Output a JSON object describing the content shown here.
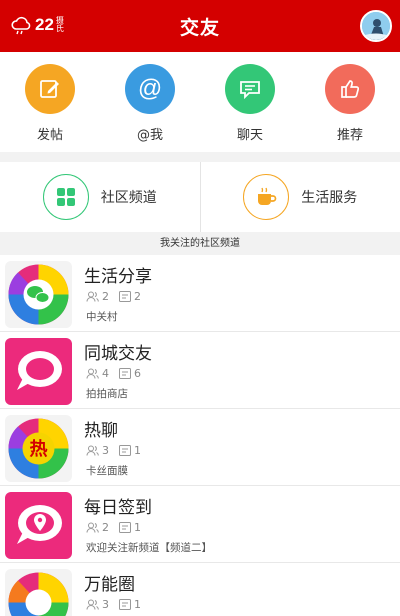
{
  "header": {
    "title": "交友",
    "weather": {
      "temperature": "22",
      "unit": "摄氏"
    }
  },
  "quick_actions": [
    {
      "label": "发帖",
      "icon": "edit-icon",
      "color": "#f5a623"
    },
    {
      "label": "@我",
      "icon": "at-icon",
      "color": "#3a9be0"
    },
    {
      "label": "聊天",
      "icon": "chat-icon",
      "color": "#33c777"
    },
    {
      "label": "推荐",
      "icon": "thumbs-up-icon",
      "color": "#f26b5b"
    }
  ],
  "services": [
    {
      "label": "社区频道",
      "icon": "grid-icon",
      "color": "#33c777"
    },
    {
      "label": "生活服务",
      "icon": "coffee-cup-icon",
      "color": "#f5a623"
    }
  ],
  "section_title": "我关注的社区频道",
  "channels": [
    {
      "name": "生活分享",
      "members": "2",
      "posts": "2",
      "subtitle": "中关村",
      "thumb_icon": "rainbow-chat-logo"
    },
    {
      "name": "同城交友",
      "members": "4",
      "posts": "6",
      "subtitle": "拍拍商店",
      "thumb_icon": "pink-speech-bubble-logo"
    },
    {
      "name": "热聊",
      "members": "3",
      "posts": "1",
      "subtitle": "卡丝面膜",
      "thumb_icon": "rainbow-hot-logo",
      "thumb_text": "热"
    },
    {
      "name": "每日签到",
      "members": "2",
      "posts": "1",
      "subtitle": "欢迎关注新频道【频道二】",
      "thumb_icon": "pink-location-logo"
    },
    {
      "name": "万能圈",
      "members": "3",
      "posts": "1",
      "subtitle": "",
      "thumb_icon": "rainbow-ring-logo"
    }
  ]
}
